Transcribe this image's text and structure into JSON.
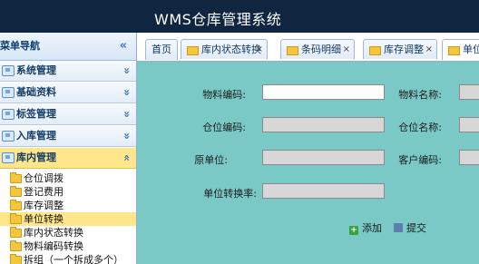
{
  "header": {
    "title": "WMS仓库管理系统"
  },
  "sidebar": {
    "title": "菜单导航",
    "collapse_icon": "«",
    "groups": [
      {
        "label": "系统管理",
        "chevron": "»"
      },
      {
        "label": "基础资料",
        "chevron": "»"
      },
      {
        "label": "标签管理",
        "chevron": "»"
      },
      {
        "label": "入库管理",
        "chevron": "»"
      },
      {
        "label": "库内管理",
        "chevron": "«"
      }
    ],
    "sub_items": [
      {
        "label": "仓位调拨"
      },
      {
        "label": "登记费用"
      },
      {
        "label": "库存调整"
      },
      {
        "label": "单位转换"
      },
      {
        "label": "库内状态转换"
      },
      {
        "label": "物料编码转换"
      },
      {
        "label": "拆组（一个拆成多个）"
      }
    ]
  },
  "tabs": [
    {
      "label": "首页"
    },
    {
      "label": "库内状态转换",
      "close": "×"
    },
    {
      "label": "条码明细",
      "close": "×"
    },
    {
      "label": "库存调整",
      "close": "×"
    },
    {
      "label": "单位"
    }
  ],
  "form": {
    "material_code_label": "物料编码:",
    "material_name_label": "物料名称:",
    "location_code_label": "仓位编码:",
    "location_name_label": "仓位名称:",
    "original_unit_label": "原单位:",
    "customer_code_label": "客户编码:",
    "unit_conversion_rate_label": "单位转换率:",
    "add_label": "添加",
    "submit_label": "提交"
  },
  "colors": {
    "header_bg": "#0f2540",
    "content_bg": "#7ac9c6",
    "active_menu": "#ffe68b"
  }
}
